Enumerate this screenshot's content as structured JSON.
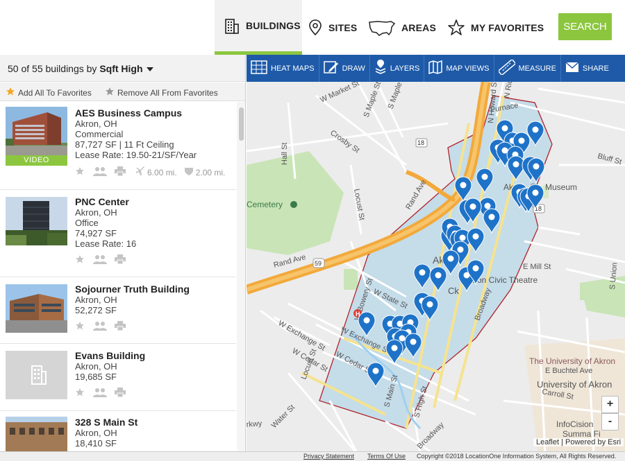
{
  "nav": {
    "tabs": [
      {
        "label": "BUILDINGS",
        "icon": "building-icon",
        "active": true
      },
      {
        "label": "SITES",
        "icon": "location-pin-icon",
        "active": false
      },
      {
        "label": "AREAS",
        "icon": "usa-map-icon",
        "active": false
      },
      {
        "label": "MY FAVORITES",
        "icon": "star-icon",
        "active": false
      }
    ],
    "search_label": "SEARCH",
    "accent_color": "#8cc63f"
  },
  "results": {
    "count_text": "50 of 55 buildings by",
    "sort_label": "Sqft High",
    "add_all_label": "Add All To Favorites",
    "remove_all_label": "Remove All From Favorites"
  },
  "buildings": [
    {
      "name": "AES Business Campus",
      "city": "Akron, OH",
      "type": "Commercial",
      "size": "87,727 SF | 11 Ft Ceiling",
      "rate": "Lease Rate: 19.50-21/SF/Year",
      "video": "VIDEO",
      "airport_dist": "6.00 mi.",
      "highway_dist": "2.00 mi."
    },
    {
      "name": "PNC Center",
      "city": "Akron, OH",
      "type": "Office",
      "size": "74,927 SF",
      "rate": "Lease Rate: 16"
    },
    {
      "name": "Sojourner Truth Building",
      "city": "Akron, OH",
      "size": "52,272 SF"
    },
    {
      "name": "Evans Building",
      "city": "Akron, OH",
      "size": "19,685 SF"
    },
    {
      "name": "328 S Main St",
      "city": "Akron, OH",
      "size": "18,410 SF"
    }
  ],
  "map_tools": [
    {
      "label": "HEAT MAPS",
      "icon": "heat-map-icon"
    },
    {
      "label": "DRAW",
      "icon": "pencil-icon"
    },
    {
      "label": "LAYERS",
      "icon": "layers-icon"
    },
    {
      "label": "MAP VIEWS",
      "icon": "map-views-icon"
    },
    {
      "label": "MEASURE",
      "icon": "ruler-icon"
    },
    {
      "label": "SHARE",
      "icon": "envelope-icon"
    }
  ],
  "map": {
    "labels": {
      "w_market": "W Market St",
      "crosby": "Crosby St",
      "maple": "S Maple St",
      "hall": "Hall St",
      "locust_n": "Locust St",
      "rand_ave_upper": "Rand Ave",
      "rand_ave_lower": "Rand Ave",
      "cemetery": "Cemetery",
      "w_exchange_1": "W Exchange St",
      "w_exchange_2": "W Exchange St",
      "w_cedar_1": "W Cedar St",
      "w_cedar_2": "W Cedar St",
      "w_bowery": "W Bowery St",
      "w_state": "W State St",
      "locust_s": "Locust St",
      "water": "Water St",
      "s_main": "S Main St",
      "s_high": "S High St",
      "broadway": "Broadway",
      "akron_museum": "Akron Art Museum",
      "akron_museum_tail": "Museum",
      "akron_museum_head": "Akron",
      "civic_theatre": "Akron Civic Theatre",
      "e_mill": "E Mill St",
      "e_buchtel": "E Buchtel Ave",
      "univ_akron": "The University of Akron",
      "univ_akron_2": "University of Akron",
      "carroll": "Carroll St",
      "infocision": "InfoCision",
      "summa": "Summa Fi",
      "bluff": "Bluff St",
      "furnace": "Furnace",
      "ridge": "N Ridge St",
      "howard": "N Howard St",
      "hwy_18": "18",
      "hwy_59": "59",
      "s_union": "S Union",
      "s_broadway": "Broadway",
      "rkwy": "rkwy",
      "e_akron": "Akro",
      "e_st": "Ck"
    },
    "zoom_in": "+",
    "zoom_out": "-",
    "attribution": "Leaflet | Powered by Esri",
    "pin_color": "#1e73c8"
  },
  "footer": {
    "privacy": "Privacy Statement",
    "terms": "Terms Of Use",
    "copyright": "Copyright ©2018 LocationOne Information System, All Rights Reserved."
  }
}
